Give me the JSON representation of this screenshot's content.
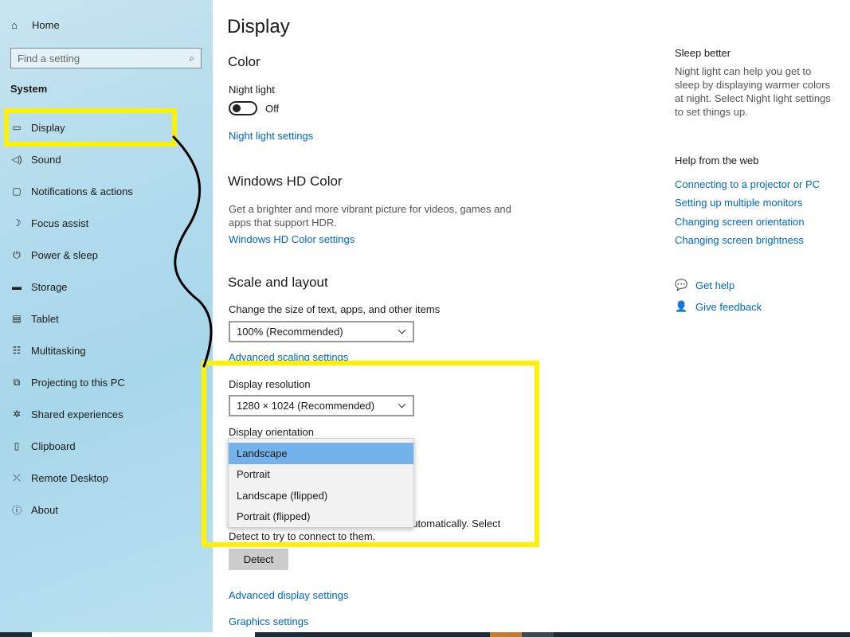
{
  "sidebar": {
    "home": {
      "label": "Home",
      "icon": "home-icon"
    },
    "search": {
      "placeholder": "Find a setting",
      "icon": "search-icon"
    },
    "section": "System",
    "items": [
      {
        "label": "Display",
        "icon": "monitor-icon",
        "active": true
      },
      {
        "label": "Sound",
        "icon": "speaker-icon"
      },
      {
        "label": "Notifications & actions",
        "icon": "notification-icon"
      },
      {
        "label": "Focus assist",
        "icon": "moon-icon"
      },
      {
        "label": "Power & sleep",
        "icon": "power-icon"
      },
      {
        "label": "Storage",
        "icon": "storage-icon"
      },
      {
        "label": "Tablet",
        "icon": "tablet-icon"
      },
      {
        "label": "Multitasking",
        "icon": "multitasking-icon"
      },
      {
        "label": "Projecting to this PC",
        "icon": "projecting-icon"
      },
      {
        "label": "Shared experiences",
        "icon": "shared-icon"
      },
      {
        "label": "Clipboard",
        "icon": "clipboard-icon"
      },
      {
        "label": "Remote Desktop",
        "icon": "remote-desktop-icon"
      },
      {
        "label": "About",
        "icon": "info-icon"
      }
    ]
  },
  "main": {
    "title": "Display",
    "color": {
      "heading": "Color",
      "night_light_label": "Night light",
      "night_light_state": "Off",
      "night_light_link": "Night light settings"
    },
    "hd_color": {
      "heading": "Windows HD Color",
      "description": "Get a brighter and more vibrant picture for videos, games and apps that support HDR.",
      "link": "Windows HD Color settings"
    },
    "scale": {
      "heading": "Scale and layout",
      "size_label": "Change the size of text, apps, and other items",
      "size_value": "100% (Recommended)",
      "advanced_link": "Advanced scaling settings",
      "resolution_label": "Display resolution",
      "resolution_value": "1280 × 1024 (Recommended)",
      "orientation_label": "Display orientation",
      "orientation_options": [
        "Landscape",
        "Portrait",
        "Landscape (flipped)",
        "Portrait (flipped)"
      ],
      "orientation_selected": "Landscape"
    },
    "multiple": {
      "text_tail": "automatically. Select",
      "text_line2": "Detect to try to connect to them.",
      "detect_button": "Detect"
    },
    "advanced_display_link": "Advanced display settings",
    "graphics_link": "Graphics settings"
  },
  "right": {
    "sleep_heading": "Sleep better",
    "sleep_desc": "Night light can help you get to sleep by displaying warmer colors at night. Select Night light settings to set things up.",
    "help_heading": "Help from the web",
    "help_links": [
      "Connecting to a projector or PC",
      "Setting up multiple monitors",
      "Changing screen orientation",
      "Changing screen brightness"
    ],
    "get_help": "Get help",
    "give_feedback": "Give feedback"
  },
  "colors": {
    "accent": "#0067c0",
    "annotation": "#fff200",
    "selected": "#74b3ea"
  }
}
